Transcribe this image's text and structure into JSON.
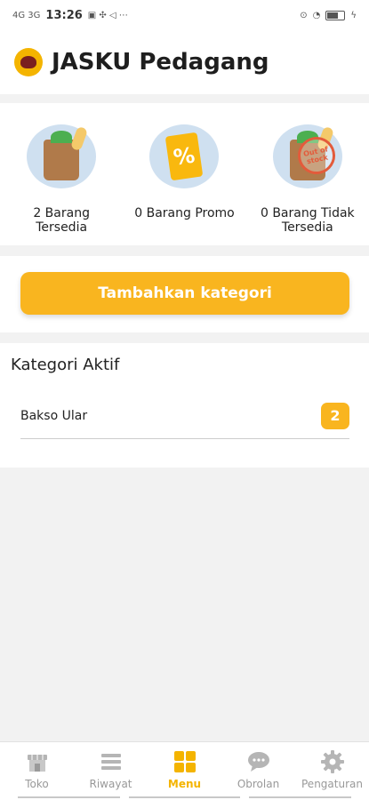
{
  "status_bar": {
    "left_text": "4G 3G",
    "time": "13:26"
  },
  "header": {
    "title": "JASKU Pedagang"
  },
  "stats": [
    {
      "label": "2 Barang\nTersedia",
      "icon": "grocery-bag-icon"
    },
    {
      "label": "0 Barang Promo",
      "icon": "promo-tag-icon"
    },
    {
      "label": "0 Barang Tidak\nTersedia",
      "icon": "out-of-stock-icon",
      "stamp_text": "Out of stock"
    }
  ],
  "cta": {
    "label": "Tambahkan kategori"
  },
  "categories": {
    "title": "Kategori Aktif",
    "items": [
      {
        "name": "Bakso Ular",
        "count": "2"
      }
    ]
  },
  "bottom_nav": [
    {
      "label": "Toko",
      "icon": "store-icon",
      "active": false
    },
    {
      "label": "Riwayat",
      "icon": "list-icon",
      "active": false
    },
    {
      "label": "Menu",
      "icon": "grid-icon",
      "active": true
    },
    {
      "label": "Obrolan",
      "icon": "chat-icon",
      "active": false
    },
    {
      "label": "Pengaturan",
      "icon": "gear-icon",
      "active": false
    }
  ],
  "colors": {
    "accent": "#f9b51f",
    "nav_active": "#f4b400",
    "nav_inactive": "#999999"
  }
}
